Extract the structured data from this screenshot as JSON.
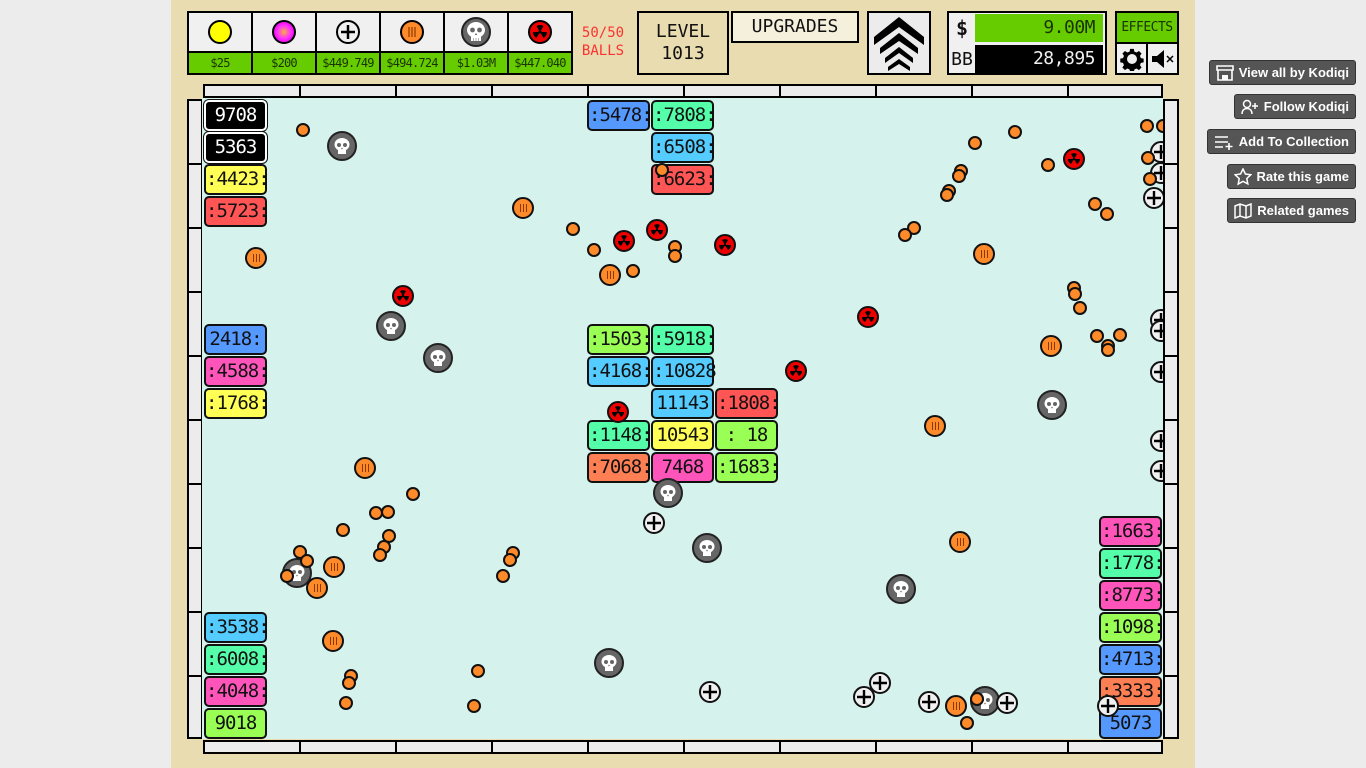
{
  "shop": {
    "items": [
      {
        "name": "basic-ball",
        "icon": "yellow-ball-icon",
        "price": "$25"
      },
      {
        "name": "plasma-ball",
        "icon": "magenta-ball-icon",
        "price": "$200"
      },
      {
        "name": "plus-ball",
        "icon": "plus-ball-icon",
        "price": "$449.749"
      },
      {
        "name": "stripe-ball",
        "icon": "stripe-ball-icon",
        "price": "$494.724"
      },
      {
        "name": "skull-ball",
        "icon": "skull-ball-icon",
        "price": "$1.03M"
      },
      {
        "name": "nuke-ball",
        "icon": "radiation-ball-icon",
        "price": "$447.040"
      }
    ],
    "balls_count": "50/50",
    "balls_label": "BALLS"
  },
  "level": {
    "label": "LEVEL",
    "value": "1013"
  },
  "upgrades_label": "UPGRADES",
  "prestige_icon": "chevrons-up-icon",
  "money": {
    "cash_symbol": "$",
    "cash": "9.00M",
    "bb_label": "BB",
    "bb": "28,895"
  },
  "effects_label": "EFFECTS",
  "colors": {
    "green": "#66cc00",
    "field": "#d6f2ec",
    "frame": "#e8dcb0",
    "brick_black": "#000000",
    "brick_yellow": "#ffff55",
    "brick_red": "#ff5555",
    "brick_blue": "#5599ff",
    "brick_mint": "#55ffaa",
    "brick_cyan": "#55ccff",
    "brick_lime": "#99ff55",
    "brick_pink": "#ff55bb",
    "brick_orange": "#ff7f55",
    "ball_orange": "#ff8a2a",
    "ball_nuke": "#ee0000"
  },
  "bricks": [
    {
      "value": "9708",
      "color": "black"
    },
    {
      "value": "5363",
      "color": "black"
    },
    {
      "value": ":4423:",
      "color": "yellow"
    },
    {
      "value": ":5723:",
      "color": "red"
    },
    {
      "value": "2418:",
      "color": "blue"
    },
    {
      "value": ":4588:",
      "color": "pink"
    },
    {
      "value": ":1768:",
      "color": "yellow"
    },
    {
      "value": ":3538:",
      "color": "cyan"
    },
    {
      "value": ":6008:",
      "color": "mint"
    },
    {
      "value": ":4048:",
      "color": "pink"
    },
    {
      "value": "9018",
      "color": "lime"
    },
    {
      "value": ":5478:",
      "color": "blue"
    },
    {
      "value": ":7808:",
      "color": "mint"
    },
    {
      "value": ":6508:",
      "color": "cyan"
    },
    {
      "value": ":6623:",
      "color": "red"
    },
    {
      "value": ":1503:",
      "color": "lime"
    },
    {
      "value": ":5918:",
      "color": "mint"
    },
    {
      "value": ":4168:",
      "color": "cyan"
    },
    {
      "value": ":10828",
      "color": "cyan"
    },
    {
      "value": "11143",
      "color": "cyan"
    },
    {
      "value": ":1808:",
      "color": "red"
    },
    {
      "value": ":1148:",
      "color": "mint"
    },
    {
      "value": "10543",
      "color": "yellow"
    },
    {
      "value": ": 18 :",
      "color": "lime"
    },
    {
      "value": ":7068:",
      "color": "orange"
    },
    {
      "value": "7468",
      "color": "pink"
    },
    {
      "value": ":1683:",
      "color": "lime"
    },
    {
      "value": ":1663:",
      "color": "pink"
    },
    {
      "value": ":1778:",
      "color": "mint"
    },
    {
      "value": ":8773:",
      "color": "pink"
    },
    {
      "value": ":1098:",
      "color": "lime"
    },
    {
      "value": ":4713:",
      "color": "blue"
    },
    {
      "value": ":3333:",
      "color": "orange"
    },
    {
      "value": "5073",
      "color": "blue"
    }
  ],
  "itch": {
    "view_all": "View all by Kodiqi",
    "follow": "Follow Kodiqi",
    "add_collection": "Add To Collection",
    "rate": "Rate this game",
    "related": "Related games"
  }
}
